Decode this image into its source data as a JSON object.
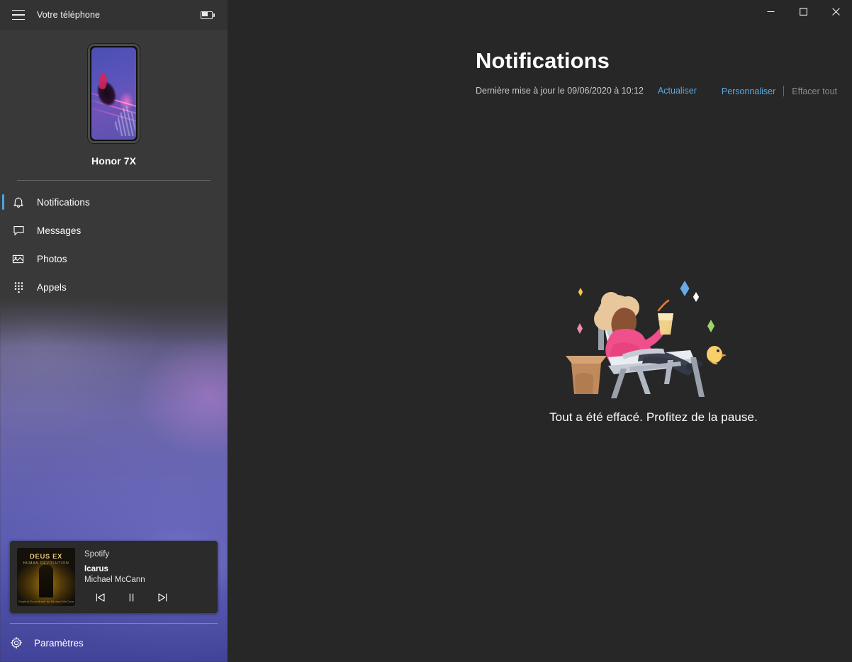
{
  "window": {
    "app_title": "Votre téléphone",
    "hamburger_icon": "hamburger-menu-icon",
    "battery_icon": "battery-icon",
    "minimize_label": "—",
    "maximize_label": "□",
    "close_label": "✕"
  },
  "sidebar": {
    "device": {
      "name": "Honor 7X",
      "screen_alt": "phone-screen-preview"
    },
    "nav": [
      {
        "label": "Notifications",
        "icon": "bell-icon",
        "active": true
      },
      {
        "label": "Messages",
        "icon": "message-icon",
        "active": false
      },
      {
        "label": "Photos",
        "icon": "photo-icon",
        "active": false
      },
      {
        "label": "Appels",
        "icon": "dialpad-icon",
        "active": false
      }
    ],
    "media": {
      "app_name": "Spotify",
      "track": "Icarus",
      "artist": "Michael McCann",
      "album_art": {
        "title": "DEUS EX",
        "subtitle": "HUMAN REVOLUTION",
        "credit": "Original Soundtrack by Michael McCann"
      },
      "controls": {
        "previous": "previous-track-icon",
        "pause": "pause-icon",
        "next": "next-track-icon"
      }
    },
    "settings": {
      "label": "Paramètres",
      "icon": "gear-icon"
    }
  },
  "main": {
    "title": "Notifications",
    "last_update": "Dernière mise à jour le 09/06/2020 à 10:12",
    "refresh_label": "Actualiser",
    "customize_label": "Personnaliser",
    "clear_all_label": "Effacer tout",
    "empty_state": {
      "message": "Tout a été effacé. Profitez de la pause.",
      "illustration": "person-relaxing-on-lounge-chair"
    }
  },
  "colors": {
    "accent": "#5aaae2",
    "sidebar_bg": "#393939",
    "main_bg": "#272727",
    "titlebar_bg": "#333333",
    "disabled_text": "#8a8a8a"
  }
}
